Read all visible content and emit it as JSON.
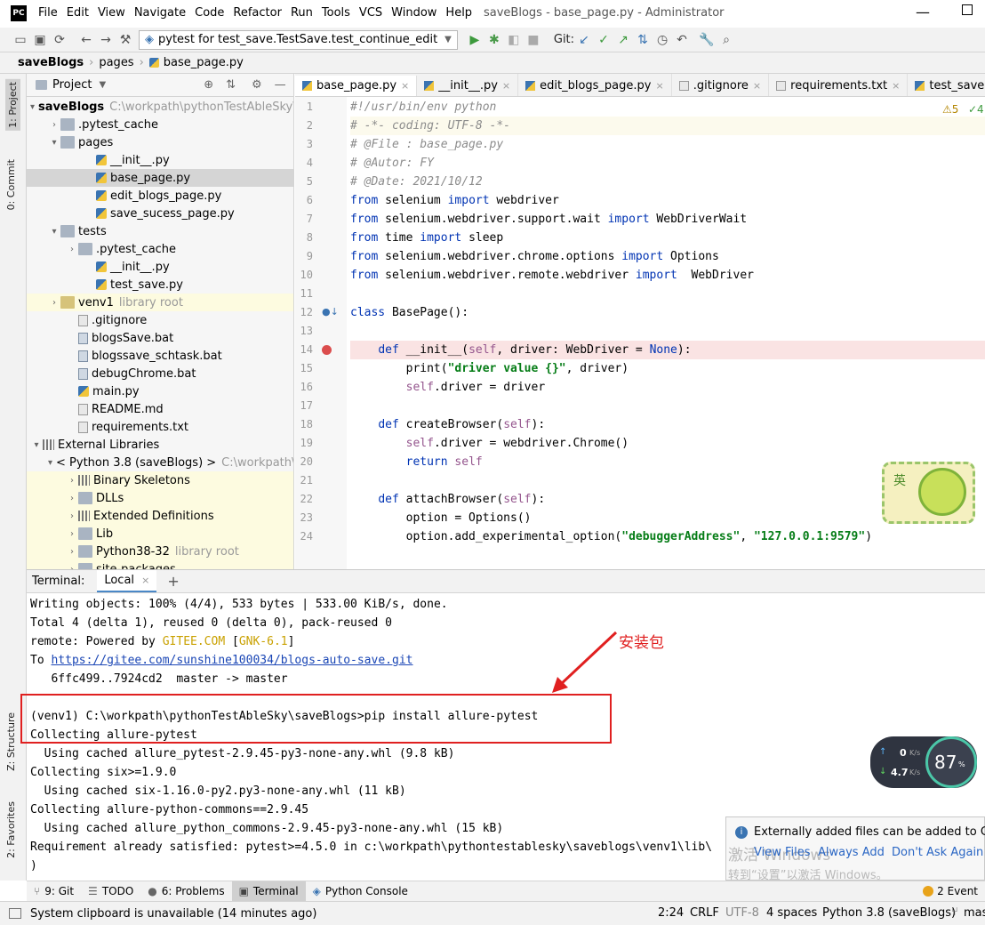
{
  "window": {
    "title": "saveBlogs - base_page.py - Administrator",
    "menu": [
      "File",
      "Edit",
      "View",
      "Navigate",
      "Code",
      "Refactor",
      "Run",
      "Tools",
      "VCS",
      "Window",
      "Help"
    ]
  },
  "toolbar": {
    "run_config": "pytest for test_save.TestSave.test_continue_edit",
    "git_label": "Git:"
  },
  "breadcrumb": [
    "saveBlogs",
    "pages",
    "base_page.py"
  ],
  "left_tabs": [
    "1: Project",
    "0: Commit",
    "Z: Structure",
    "2: Favorites"
  ],
  "project": {
    "header": "Project",
    "tree": [
      {
        "label": "saveBlogs",
        "hint": "C:\\workpath\\pythonTestAbleSky\\s",
        "indent": 0,
        "arrow": "▾",
        "icon": "folder",
        "bold": true
      },
      {
        "label": ".pytest_cache",
        "indent": 1,
        "arrow": "›",
        "icon": "folder"
      },
      {
        "label": "pages",
        "indent": 1,
        "arrow": "▾",
        "icon": "folder"
      },
      {
        "label": "__init__.py",
        "indent": 3,
        "arrow": "",
        "icon": "py"
      },
      {
        "label": "base_page.py",
        "indent": 3,
        "arrow": "",
        "icon": "py",
        "selected": true
      },
      {
        "label": "edit_blogs_page.py",
        "indent": 3,
        "arrow": "",
        "icon": "py"
      },
      {
        "label": "save_sucess_page.py",
        "indent": 3,
        "arrow": "",
        "icon": "py"
      },
      {
        "label": "tests",
        "indent": 1,
        "arrow": "▾",
        "icon": "folder"
      },
      {
        "label": ".pytest_cache",
        "indent": 2,
        "arrow": "›",
        "icon": "folder"
      },
      {
        "label": "__init__.py",
        "indent": 3,
        "arrow": "",
        "icon": "py"
      },
      {
        "label": "test_save.py",
        "indent": 3,
        "arrow": "",
        "icon": "py"
      },
      {
        "label": "venv1",
        "hint": "library root",
        "indent": 1,
        "arrow": "›",
        "icon": "folder-yellow",
        "highlight": true
      },
      {
        "label": ".gitignore",
        "indent": 2,
        "arrow": "",
        "icon": "file"
      },
      {
        "label": "blogsSave.bat",
        "indent": 2,
        "arrow": "",
        "icon": "bat"
      },
      {
        "label": "blogssave_schtask.bat",
        "indent": 2,
        "arrow": "",
        "icon": "bat"
      },
      {
        "label": "debugChrome.bat",
        "indent": 2,
        "arrow": "",
        "icon": "bat"
      },
      {
        "label": "main.py",
        "indent": 2,
        "arrow": "",
        "icon": "py"
      },
      {
        "label": "README.md",
        "indent": 2,
        "arrow": "",
        "icon": "file"
      },
      {
        "label": "requirements.txt",
        "indent": 2,
        "arrow": "",
        "icon": "file"
      },
      {
        "label": "External Libraries",
        "indent": 0,
        "arrow": "▾",
        "icon": "libs"
      },
      {
        "label": "< Python 3.8 (saveBlogs) >",
        "hint": "C:\\workpath\\",
        "indent": 1,
        "arrow": "▾",
        "icon": "py"
      },
      {
        "label": "Binary Skeletons",
        "indent": 2,
        "arrow": "›",
        "icon": "libs",
        "highlight": true
      },
      {
        "label": "DLLs",
        "indent": 2,
        "arrow": "›",
        "icon": "folder",
        "highlight": true
      },
      {
        "label": "Extended Definitions",
        "indent": 2,
        "arrow": "›",
        "icon": "libs",
        "highlight": true
      },
      {
        "label": "Lib",
        "indent": 2,
        "arrow": "›",
        "icon": "folder",
        "highlight": true
      },
      {
        "label": "Python38-32",
        "hint": "library root",
        "indent": 2,
        "arrow": "›",
        "icon": "folder",
        "highlight": true
      },
      {
        "label": "site-packages",
        "indent": 2,
        "arrow": "›",
        "icon": "folder",
        "highlight": true
      }
    ]
  },
  "editor": {
    "tabs": [
      {
        "label": "base_page.py",
        "active": true
      },
      {
        "label": "__init__.py"
      },
      {
        "label": "edit_blogs_page.py"
      },
      {
        "label": ".gitignore"
      },
      {
        "label": "requirements.txt"
      },
      {
        "label": "test_save.py"
      }
    ],
    "inspection": "⚠5",
    "inspection_ok": "✓4",
    "lines": [
      [
        [
          "cm",
          "#!/usr/bin/env python"
        ]
      ],
      [
        [
          "cm",
          "# -*- coding: UTF-8 -*-"
        ]
      ],
      [
        [
          "cm",
          "# @File : base_page.py"
        ]
      ],
      [
        [
          "cm",
          "# @Autor: FY"
        ]
      ],
      [
        [
          "cm",
          "# @Date: 2021/10/12"
        ]
      ],
      [
        [
          "kw",
          "from"
        ],
        [
          "",
          " selenium "
        ],
        [
          "kw",
          "import"
        ],
        [
          "",
          " webdriver"
        ]
      ],
      [
        [
          "kw",
          "from"
        ],
        [
          "",
          " selenium.webdriver.support.wait "
        ],
        [
          "kw",
          "import"
        ],
        [
          "",
          " WebDriverWait"
        ]
      ],
      [
        [
          "kw",
          "from"
        ],
        [
          "",
          " time "
        ],
        [
          "kw",
          "import"
        ],
        [
          "",
          " sleep"
        ]
      ],
      [
        [
          "kw",
          "from"
        ],
        [
          "",
          " selenium.webdriver.chrome.options "
        ],
        [
          "kw",
          "import"
        ],
        [
          "",
          " Options"
        ]
      ],
      [
        [
          "kw",
          "from"
        ],
        [
          "",
          " selenium.webdriver.remote.webdriver "
        ],
        [
          "kw",
          "import"
        ],
        [
          "",
          "  WebDriver"
        ]
      ],
      [
        [
          "",
          ""
        ]
      ],
      [
        [
          "kw",
          "class"
        ],
        [
          "",
          " BasePage():"
        ]
      ],
      [
        [
          "",
          ""
        ]
      ],
      [
        [
          "",
          "    "
        ],
        [
          "kw",
          "def"
        ],
        [
          "",
          " __init__("
        ],
        [
          "sf",
          "self"
        ],
        [
          "",
          ", driver: WebDriver = "
        ],
        [
          "kw",
          "None"
        ],
        [
          "",
          "):"
        ]
      ],
      [
        [
          "",
          "        print("
        ],
        [
          "st",
          "\"driver value {}\""
        ],
        [
          "",
          ", driver)"
        ]
      ],
      [
        [
          "",
          "        "
        ],
        [
          "sf",
          "self"
        ],
        [
          "",
          ".driver = driver"
        ]
      ],
      [
        [
          "",
          ""
        ]
      ],
      [
        [
          "",
          "    "
        ],
        [
          "kw",
          "def"
        ],
        [
          "",
          " createBrowser("
        ],
        [
          "sf",
          "self"
        ],
        [
          "",
          "):"
        ]
      ],
      [
        [
          "",
          "        "
        ],
        [
          "sf",
          "self"
        ],
        [
          "",
          ".driver = webdriver.Chrome()"
        ]
      ],
      [
        [
          "",
          "        "
        ],
        [
          "kw",
          "return"
        ],
        [
          "",
          " "
        ],
        [
          "sf",
          "self"
        ]
      ],
      [
        [
          "",
          ""
        ]
      ],
      [
        [
          "",
          "    "
        ],
        [
          "kw",
          "def"
        ],
        [
          "",
          " attachBrowser("
        ],
        [
          "sf",
          "self"
        ],
        [
          "",
          "):"
        ]
      ],
      [
        [
          "",
          "        option = Options()"
        ]
      ],
      [
        [
          "",
          "        option.add_experimental_option("
        ],
        [
          "st",
          "\"debuggerAddress\""
        ],
        [
          "",
          ", "
        ],
        [
          "st",
          "\"127.0.0.1:9579\""
        ],
        [
          "",
          ")"
        ]
      ]
    ],
    "breakpoint_line": 14,
    "mascot_char": "英"
  },
  "terminal": {
    "label": "Terminal:",
    "tab": "Local",
    "lines": [
      [
        [
          "",
          "Writing objects: 100% (4/4), 533 bytes | 533.00 KiB/s, done."
        ]
      ],
      [
        [
          "",
          "Total 4 (delta 1), reused 0 (delta 0), pack-reused 0"
        ]
      ],
      [
        [
          "",
          "remote: Powered by "
        ],
        [
          "gitee",
          "GITEE.COM"
        ],
        [
          "",
          " ["
        ],
        [
          "gitee",
          "GNK-6.1"
        ],
        [
          "",
          "]"
        ]
      ],
      [
        [
          "",
          "To "
        ],
        [
          "link",
          "https://gitee.com/sunshine100034/blogs-auto-save.git"
        ]
      ],
      [
        [
          "",
          "   6ffc499..7924cd2  master -> master"
        ]
      ],
      [
        [
          "",
          ""
        ]
      ],
      [
        [
          "",
          "(venv1) C:\\workpath\\pythonTestAbleSky\\saveBlogs>pip install allure-pytest"
        ]
      ],
      [
        [
          "",
          "Collecting allure-pytest"
        ]
      ],
      [
        [
          "",
          "  Using cached allure_pytest-2.9.45-py3-none-any.whl (9.8 kB)"
        ]
      ],
      [
        [
          "",
          "Collecting six>=1.9.0"
        ]
      ],
      [
        [
          "",
          "  Using cached six-1.16.0-py2.py3-none-any.whl (11 kB)"
        ]
      ],
      [
        [
          "",
          "Collecting allure-python-commons==2.9.45"
        ]
      ],
      [
        [
          "",
          "  Using cached allure_python_commons-2.9.45-py3-none-any.whl (15 kB)"
        ]
      ],
      [
        [
          "",
          "Requirement already satisfied: pytest>=4.5.0 in c:\\workpath\\pythontestablesky\\saveblogs\\venv1\\lib\\"
        ]
      ],
      [
        [
          "",
          ")"
        ]
      ]
    ],
    "annotation": "安装包"
  },
  "bottom_tabs": [
    "9: Git",
    "TODO",
    "6: Problems",
    "Terminal",
    "Python Console"
  ],
  "event_log": "2 Event",
  "notification": {
    "text": "Externally added files can be added to Git",
    "actions": [
      "View Files",
      "Always Add",
      "Don't Ask Again"
    ],
    "watermark_1": "激活 Windows",
    "watermark_2": "转到“设置”以激活 Windows。"
  },
  "netwidget": {
    "up": "0",
    "up_unit": "K/s",
    "down": "4.7",
    "down_unit": "K/s",
    "percent": "87",
    "percent_sign": "%"
  },
  "status": {
    "message": "System clipboard is unavailable (14 minutes ago)",
    "position": "2:24",
    "line_sep": "CRLF",
    "encoding": "UTF-8",
    "indent": "4 spaces",
    "interpreter": "Python 3.8 (saveBlogs)",
    "branch": "mas"
  },
  "colors": {
    "accent": "#4a88c7",
    "annotation_red": "#e02020",
    "keyword": "#0033b3",
    "string": "#067d17",
    "self": "#94558d"
  }
}
